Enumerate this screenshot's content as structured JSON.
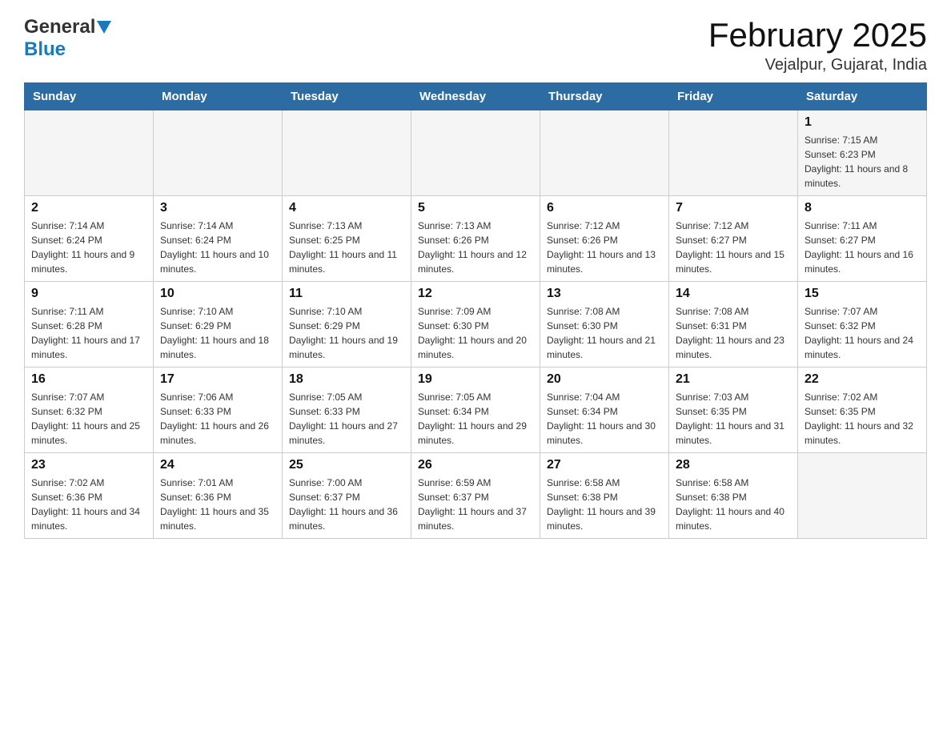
{
  "header": {
    "logo_general": "General",
    "logo_blue": "Blue",
    "month_title": "February 2025",
    "location": "Vejalpur, Gujarat, India"
  },
  "weekdays": [
    "Sunday",
    "Monday",
    "Tuesday",
    "Wednesday",
    "Thursday",
    "Friday",
    "Saturday"
  ],
  "weeks": [
    [
      {
        "day": "",
        "info": ""
      },
      {
        "day": "",
        "info": ""
      },
      {
        "day": "",
        "info": ""
      },
      {
        "day": "",
        "info": ""
      },
      {
        "day": "",
        "info": ""
      },
      {
        "day": "",
        "info": ""
      },
      {
        "day": "1",
        "info": "Sunrise: 7:15 AM\nSunset: 6:23 PM\nDaylight: 11 hours and 8 minutes."
      }
    ],
    [
      {
        "day": "2",
        "info": "Sunrise: 7:14 AM\nSunset: 6:24 PM\nDaylight: 11 hours and 9 minutes."
      },
      {
        "day": "3",
        "info": "Sunrise: 7:14 AM\nSunset: 6:24 PM\nDaylight: 11 hours and 10 minutes."
      },
      {
        "day": "4",
        "info": "Sunrise: 7:13 AM\nSunset: 6:25 PM\nDaylight: 11 hours and 11 minutes."
      },
      {
        "day": "5",
        "info": "Sunrise: 7:13 AM\nSunset: 6:26 PM\nDaylight: 11 hours and 12 minutes."
      },
      {
        "day": "6",
        "info": "Sunrise: 7:12 AM\nSunset: 6:26 PM\nDaylight: 11 hours and 13 minutes."
      },
      {
        "day": "7",
        "info": "Sunrise: 7:12 AM\nSunset: 6:27 PM\nDaylight: 11 hours and 15 minutes."
      },
      {
        "day": "8",
        "info": "Sunrise: 7:11 AM\nSunset: 6:27 PM\nDaylight: 11 hours and 16 minutes."
      }
    ],
    [
      {
        "day": "9",
        "info": "Sunrise: 7:11 AM\nSunset: 6:28 PM\nDaylight: 11 hours and 17 minutes."
      },
      {
        "day": "10",
        "info": "Sunrise: 7:10 AM\nSunset: 6:29 PM\nDaylight: 11 hours and 18 minutes."
      },
      {
        "day": "11",
        "info": "Sunrise: 7:10 AM\nSunset: 6:29 PM\nDaylight: 11 hours and 19 minutes."
      },
      {
        "day": "12",
        "info": "Sunrise: 7:09 AM\nSunset: 6:30 PM\nDaylight: 11 hours and 20 minutes."
      },
      {
        "day": "13",
        "info": "Sunrise: 7:08 AM\nSunset: 6:30 PM\nDaylight: 11 hours and 21 minutes."
      },
      {
        "day": "14",
        "info": "Sunrise: 7:08 AM\nSunset: 6:31 PM\nDaylight: 11 hours and 23 minutes."
      },
      {
        "day": "15",
        "info": "Sunrise: 7:07 AM\nSunset: 6:32 PM\nDaylight: 11 hours and 24 minutes."
      }
    ],
    [
      {
        "day": "16",
        "info": "Sunrise: 7:07 AM\nSunset: 6:32 PM\nDaylight: 11 hours and 25 minutes."
      },
      {
        "day": "17",
        "info": "Sunrise: 7:06 AM\nSunset: 6:33 PM\nDaylight: 11 hours and 26 minutes."
      },
      {
        "day": "18",
        "info": "Sunrise: 7:05 AM\nSunset: 6:33 PM\nDaylight: 11 hours and 27 minutes."
      },
      {
        "day": "19",
        "info": "Sunrise: 7:05 AM\nSunset: 6:34 PM\nDaylight: 11 hours and 29 minutes."
      },
      {
        "day": "20",
        "info": "Sunrise: 7:04 AM\nSunset: 6:34 PM\nDaylight: 11 hours and 30 minutes."
      },
      {
        "day": "21",
        "info": "Sunrise: 7:03 AM\nSunset: 6:35 PM\nDaylight: 11 hours and 31 minutes."
      },
      {
        "day": "22",
        "info": "Sunrise: 7:02 AM\nSunset: 6:35 PM\nDaylight: 11 hours and 32 minutes."
      }
    ],
    [
      {
        "day": "23",
        "info": "Sunrise: 7:02 AM\nSunset: 6:36 PM\nDaylight: 11 hours and 34 minutes."
      },
      {
        "day": "24",
        "info": "Sunrise: 7:01 AM\nSunset: 6:36 PM\nDaylight: 11 hours and 35 minutes."
      },
      {
        "day": "25",
        "info": "Sunrise: 7:00 AM\nSunset: 6:37 PM\nDaylight: 11 hours and 36 minutes."
      },
      {
        "day": "26",
        "info": "Sunrise: 6:59 AM\nSunset: 6:37 PM\nDaylight: 11 hours and 37 minutes."
      },
      {
        "day": "27",
        "info": "Sunrise: 6:58 AM\nSunset: 6:38 PM\nDaylight: 11 hours and 39 minutes."
      },
      {
        "day": "28",
        "info": "Sunrise: 6:58 AM\nSunset: 6:38 PM\nDaylight: 11 hours and 40 minutes."
      },
      {
        "day": "",
        "info": ""
      }
    ]
  ]
}
